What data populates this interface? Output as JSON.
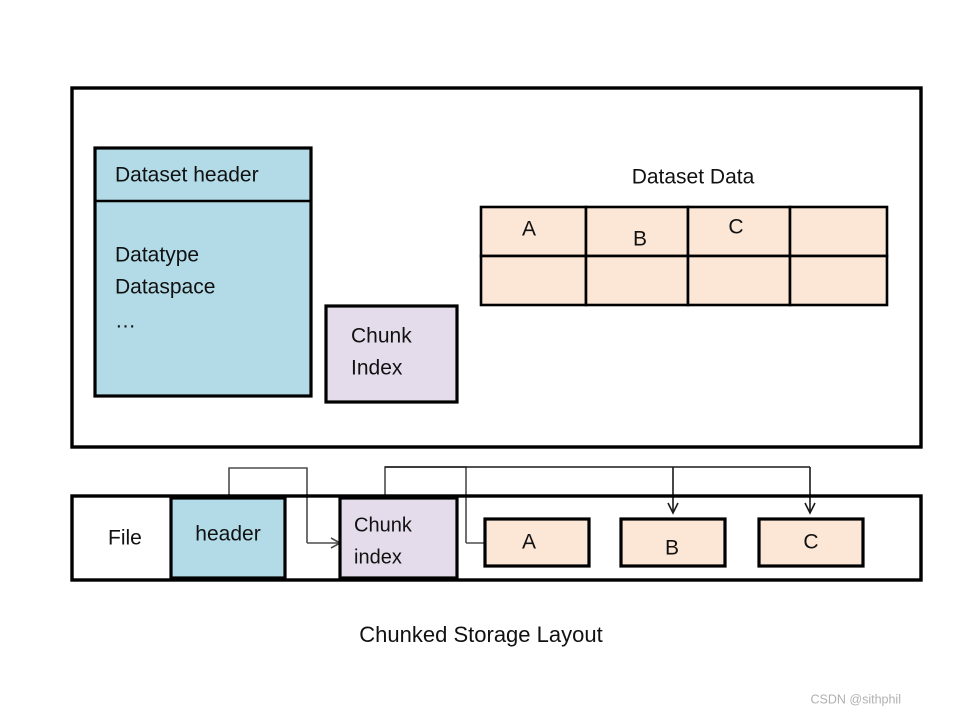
{
  "figure": {
    "caption": "Chunked Storage Layout",
    "watermark": "CSDN @sithphil"
  },
  "colors": {
    "header_fill": "#b2dbe7",
    "index_fill": "#e4dcea",
    "data_fill": "#fce7d7",
    "panel_fill": "#ffffff",
    "stroke": "#000000",
    "arrow": "#4d4d4d",
    "watermark": "#b0b0b0"
  },
  "top_panel": {
    "name": "dataset-object-panel",
    "dataset_object": {
      "header_label": "Dataset header",
      "body_lines": [
        "Datatype",
        "Dataspace",
        "…"
      ]
    },
    "chunk_index": {
      "lines": [
        "Chunk",
        "Index"
      ]
    },
    "dataset_data": {
      "title": "Dataset Data",
      "rows": [
        [
          "A",
          "B",
          "C",
          ""
        ],
        [
          "",
          "",
          "",
          ""
        ]
      ],
      "columns": 4,
      "row_count": 2
    }
  },
  "bottom_panel": {
    "name": "file-layout-panel",
    "file_label": "File",
    "header_block": "header",
    "chunk_index_block": [
      "Chunk",
      "index"
    ],
    "chunk_blocks": [
      "A",
      "B",
      "C"
    ]
  },
  "connectors": [
    {
      "name": "header-to-chunk-index",
      "from": "header-block",
      "to": "chunk-index-block"
    },
    {
      "name": "chunk-index-to-chunk-a",
      "from": "chunk-index-block",
      "to": "chunk-block-a"
    },
    {
      "name": "chunk-index-to-chunk-b",
      "from": "chunk-index-block",
      "to": "chunk-block-b"
    },
    {
      "name": "chunk-index-to-chunk-c",
      "from": "chunk-index-block",
      "to": "chunk-block-c"
    }
  ]
}
